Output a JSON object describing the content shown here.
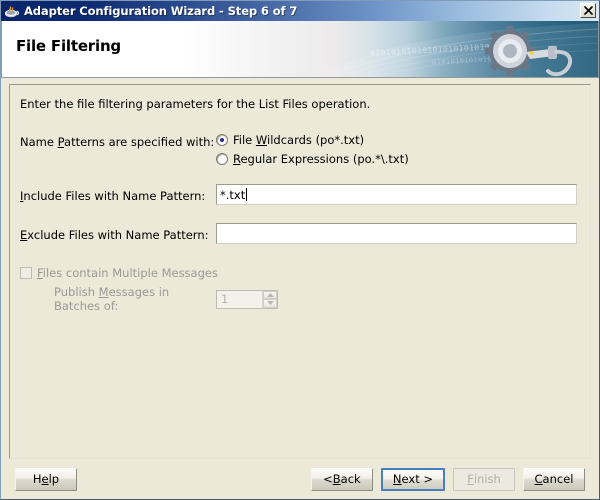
{
  "window": {
    "title": "Adapter Configuration Wizard - Step 6 of 7",
    "icon": "java-coffee-cup-icon",
    "close_label": "✕"
  },
  "banner": {
    "heading": "File Filtering",
    "graphic": "gear-and-plug-icon",
    "binary_line_1": "0101010101010101010101010101",
    "binary_line_2": "0101010101010"
  },
  "content": {
    "intro": "Enter the file filtering parameters for the List Files operation.",
    "name_patterns": {
      "label_pre": "Name ",
      "label_mnemonic": "P",
      "label_post": "atterns are specified with:",
      "options": [
        {
          "pre": "File ",
          "mnemonic": "W",
          "post": "ildcards (po*.txt)",
          "selected": true
        },
        {
          "pre": "",
          "mnemonic": "R",
          "post": "egular Expressions (po.*\\.txt)",
          "selected": false
        }
      ]
    },
    "include_field": {
      "label_pre": "",
      "label_mnemonic": "I",
      "label_post": "nclude Files with Name Pattern:",
      "value": "*.txt",
      "placeholder": ""
    },
    "exclude_field": {
      "label_pre": "",
      "label_mnemonic": "E",
      "label_post": "xclude Files with Name Pattern:",
      "value": "",
      "placeholder": ""
    },
    "multiple_messages": {
      "label_pre": "",
      "label_mnemonic": "F",
      "label_post": "iles contain Multiple Messages",
      "checked": false,
      "enabled": false
    },
    "batch": {
      "label_pre": "Publish ",
      "label_mnemonic": "M",
      "label_post": "essages in Batches of:",
      "value": "1",
      "enabled": false
    }
  },
  "buttons": {
    "help": {
      "pre": "H",
      "mnemonic": "e",
      "post": "lp"
    },
    "back": {
      "pre": "< ",
      "mnemonic": "B",
      "post": "ack"
    },
    "next": {
      "pre": "",
      "mnemonic": "N",
      "post": "ext >"
    },
    "finish": {
      "pre": "",
      "mnemonic": "F",
      "post": "inish"
    },
    "cancel": {
      "pre": "",
      "mnemonic": "C",
      "post": "ancel"
    }
  },
  "colors": {
    "title_start": "#0a246a",
    "title_end": "#d8e7f3",
    "banner_end": "#1d5874",
    "panel_bg": "#ece9d8",
    "focus_ring": "#4a7fbf",
    "radio_dot": "#21318c"
  }
}
